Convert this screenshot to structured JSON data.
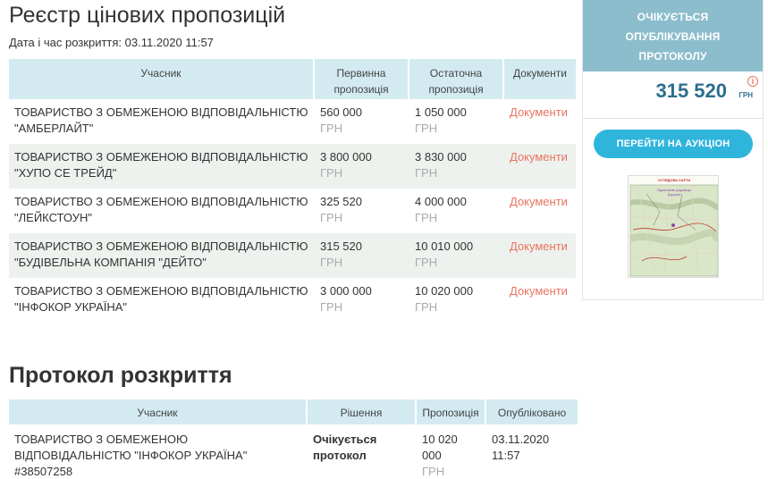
{
  "bids": {
    "title": "Реєстр цінових пропозицій",
    "datetime": "Дата і час розкриття: 03.11.2020 11:57",
    "headers": {
      "participant": "Учасник",
      "initial": "Первинна пропозиція",
      "final": "Остаточна пропозиція",
      "documents": "Документи"
    },
    "rows": [
      {
        "name": "ТОВАРИСТВО З ОБМЕЖЕНОЮ ВІДПОВІДАЛЬНІСТЮ \"АМБЕРЛАЙТ\"",
        "initial": "560 000",
        "final": "1 050 000",
        "currency": "ГРН",
        "documents": "Документи"
      },
      {
        "name": "ТОВАРИСТВО З ОБМЕЖЕНОЮ ВІДПОВІДАЛЬНІСТЮ \"ХУПО СЕ ТРЕЙД\"",
        "initial": "3 800 000",
        "final": "3 830 000",
        "currency": "ГРН",
        "documents": "Документи"
      },
      {
        "name": "ТОВАРИСТВО З ОБМЕЖЕНОЮ ВІДПОВІДАЛЬНІСТЮ \"ЛЕЙКСТОУН\"",
        "initial": "325 520",
        "final": "4 000 000",
        "currency": "ГРН",
        "documents": "Документи"
      },
      {
        "name": "ТОВАРИСТВО З ОБМЕЖЕНОЮ ВІДПОВІДАЛЬНІСТЮ \"БУДІВЕЛЬНА КОМПАНІЯ \"ДЕЙТО\"",
        "initial": "315 520",
        "final": "10 010 000",
        "currency": "ГРН",
        "documents": "Документи"
      },
      {
        "name": "ТОВАРИСТВО З ОБМЕЖЕНОЮ ВІДПОВІДАЛЬНІСТЮ \"ІНФОКОР УКРАЇНА\"",
        "initial": "3 000 000",
        "final": "10 020 000",
        "currency": "ГРН",
        "documents": "Документи"
      }
    ]
  },
  "protocol": {
    "title": "Протокол розкриття",
    "headers": {
      "participant": "Учасник",
      "decision": "Рішення",
      "offer": "Пропозиція",
      "published": "Опубліковано"
    },
    "row": {
      "name": "ТОВАРИСТВО З ОБМЕЖЕНОЮ ВІДПОВІДАЛЬНІСТЮ \"ІНФОКОР УКРАЇНА\"",
      "code": "#38507258",
      "decision_line1": "Очікується",
      "decision_line2": "протокол",
      "offer_line1": "10 020",
      "offer_line2": "000",
      "currency": "ГРН",
      "published_date": "03.11.2020",
      "published_time": "11:57"
    }
  },
  "sidebar": {
    "status_line1": "ОЧІКУЄТЬСЯ",
    "status_line2": "ОПУБЛІКУВАННЯ",
    "status_line3": "ПРОТОКОЛУ",
    "price": "315 520",
    "currency": "ГРН",
    "info_glyph": "i",
    "auction_button": "ПЕРЕЙТИ НА АУКЦІОН",
    "map_caption_1": "ОГЛЯДОВА КАРТА",
    "map_caption_2": "Бурштинове родовище",
    "map_caption_3": "Бурштин",
    "status_color": "#8cbdcc",
    "accent_color": "#2fb5dc",
    "link_color": "#e87461"
  }
}
